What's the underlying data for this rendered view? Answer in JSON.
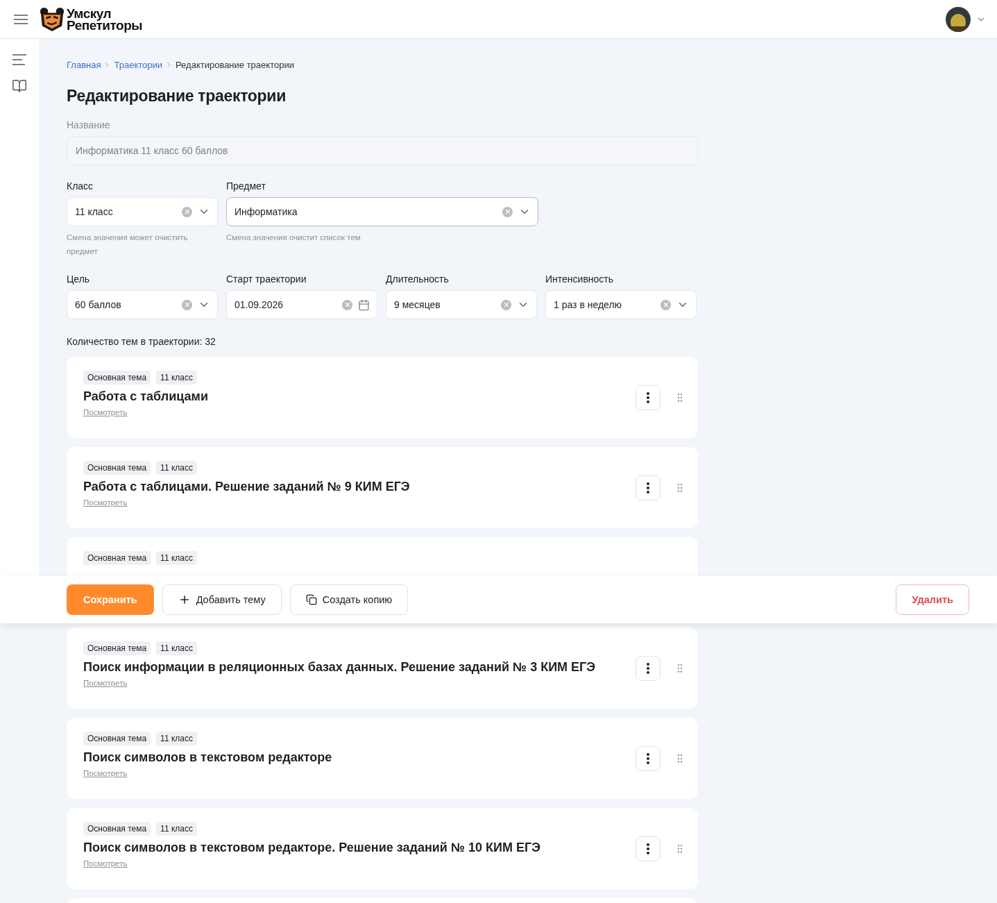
{
  "header": {
    "logo": {
      "line1": "Умскул",
      "line2": "Репетиторы"
    }
  },
  "breadcrumbs": [
    {
      "label": "Главная",
      "link": true
    },
    {
      "label": "Траектории",
      "link": true
    },
    {
      "label": "Редактирование траектории",
      "link": false
    }
  ],
  "title": "Редактирование траектории",
  "name_field": {
    "label": "Название",
    "value": "Информатика 11 класс 60 баллов",
    "disabled": true
  },
  "rows": [
    [
      {
        "label": "Класс",
        "value": "11 класс",
        "kind": "select",
        "focused": false,
        "hint": "Смена значения может очистить предмет"
      },
      {
        "label": "Предмет",
        "value": "Информатика",
        "kind": "select",
        "focused": true,
        "hint": "Смена значения очистит список тем"
      }
    ],
    [
      {
        "label": "Цель",
        "value": "60 баллов",
        "kind": "select",
        "focused": false
      },
      {
        "label": "Старт траектории",
        "value": "01.09.2026",
        "kind": "date",
        "focused": false
      },
      {
        "label": "Длительность",
        "value": "9 месяцев",
        "kind": "select",
        "focused": false
      },
      {
        "label": "Интенсивность",
        "value": "1 раз в неделю",
        "kind": "select",
        "focused": false
      }
    ]
  ],
  "topic_count": "Количество тем в траектории: 32",
  "topics": [
    {
      "kind": "topic",
      "tags": [
        "Основная тема",
        "11 класс"
      ],
      "title": "Работа с таблицами",
      "link": "Посмотреть"
    },
    {
      "kind": "topic",
      "tags": [
        "Основная тема",
        "11 класс"
      ],
      "title": "Работа с таблицами. Решение заданий № 9 КИМ ЕГЭ",
      "link": "Посмотреть"
    },
    {
      "kind": "cut",
      "tags": [
        "Основная тема",
        "11 класс"
      ]
    },
    {
      "kind": "topic",
      "tags": [
        "Основная тема",
        "11 класс"
      ],
      "title": "Поиск информации в реляционных базах данных. Решение заданий № 3 КИМ ЕГЭ",
      "link": "Посмотреть"
    },
    {
      "kind": "topic",
      "tags": [
        "Основная тема",
        "11 класс"
      ],
      "title": "Поиск символов в текстовом редакторе",
      "link": "Посмотреть"
    },
    {
      "kind": "topic",
      "tags": [
        "Основная тема",
        "11 класс"
      ],
      "title": "Поиск символов в текстовом редакторе. Решение заданий № 10 КИМ ЕГЭ",
      "link": "Посмотреть"
    },
    {
      "kind": "partial"
    }
  ],
  "actions": [
    {
      "label": "Сохранить",
      "kind": "primary"
    },
    {
      "label": "Добавить тему",
      "kind": "add"
    },
    {
      "label": "Создать копию",
      "kind": "copy"
    },
    {
      "label": "Удалить",
      "kind": "danger"
    }
  ]
}
